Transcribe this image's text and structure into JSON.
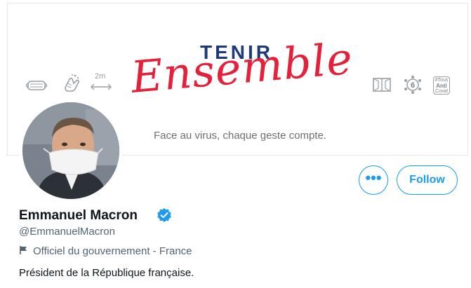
{
  "banner": {
    "title": "TENIR",
    "script": "Ensemble",
    "tagline": "Face au virus, chaque geste compte.",
    "distance_label": "2m",
    "anti_box": {
      "line1": "#Tous",
      "line2": "Anti",
      "line3": "Covid"
    },
    "number_badge": "6",
    "colors": {
      "title": "#1f3a78",
      "script": "#e5203a",
      "icons": "#9aa0a6"
    },
    "icons": [
      "mask-icon",
      "handwash-icon",
      "distance-icon",
      "window-icon",
      "six-people-icon",
      "app-icon"
    ]
  },
  "profile": {
    "name": "Emmanuel Macron",
    "handle": "@EmmanuelMacron",
    "affiliation": "Officiel du gouvernement - France",
    "bio": "Président de la République française.",
    "verified": true
  },
  "actions": {
    "more_label": "•••",
    "follow_label": "Follow",
    "accent": "#1d9bf0"
  }
}
